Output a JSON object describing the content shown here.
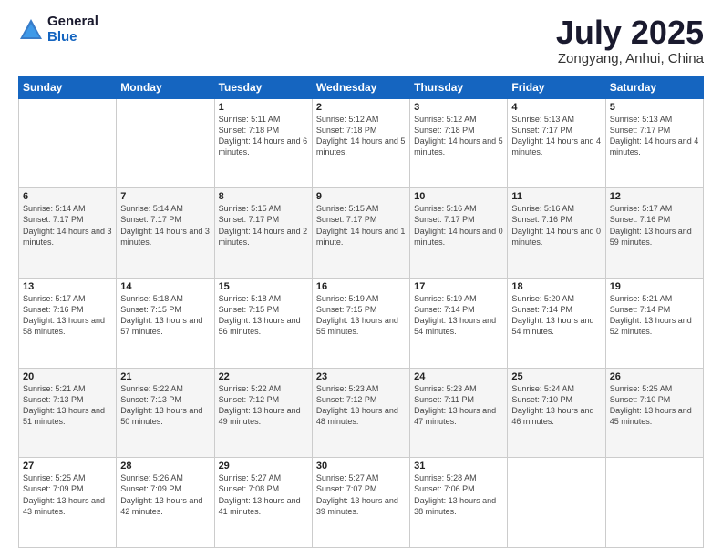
{
  "header": {
    "logo_general": "General",
    "logo_blue": "Blue",
    "month_title": "July 2025",
    "location": "Zongyang, Anhui, China"
  },
  "weekdays": [
    "Sunday",
    "Monday",
    "Tuesday",
    "Wednesday",
    "Thursday",
    "Friday",
    "Saturday"
  ],
  "weeks": [
    [
      {
        "day": "",
        "info": ""
      },
      {
        "day": "",
        "info": ""
      },
      {
        "day": "1",
        "info": "Sunrise: 5:11 AM\nSunset: 7:18 PM\nDaylight: 14 hours and 6 minutes."
      },
      {
        "day": "2",
        "info": "Sunrise: 5:12 AM\nSunset: 7:18 PM\nDaylight: 14 hours and 5 minutes."
      },
      {
        "day": "3",
        "info": "Sunrise: 5:12 AM\nSunset: 7:18 PM\nDaylight: 14 hours and 5 minutes."
      },
      {
        "day": "4",
        "info": "Sunrise: 5:13 AM\nSunset: 7:17 PM\nDaylight: 14 hours and 4 minutes."
      },
      {
        "day": "5",
        "info": "Sunrise: 5:13 AM\nSunset: 7:17 PM\nDaylight: 14 hours and 4 minutes."
      }
    ],
    [
      {
        "day": "6",
        "info": "Sunrise: 5:14 AM\nSunset: 7:17 PM\nDaylight: 14 hours and 3 minutes."
      },
      {
        "day": "7",
        "info": "Sunrise: 5:14 AM\nSunset: 7:17 PM\nDaylight: 14 hours and 3 minutes."
      },
      {
        "day": "8",
        "info": "Sunrise: 5:15 AM\nSunset: 7:17 PM\nDaylight: 14 hours and 2 minutes."
      },
      {
        "day": "9",
        "info": "Sunrise: 5:15 AM\nSunset: 7:17 PM\nDaylight: 14 hours and 1 minute."
      },
      {
        "day": "10",
        "info": "Sunrise: 5:16 AM\nSunset: 7:17 PM\nDaylight: 14 hours and 0 minutes."
      },
      {
        "day": "11",
        "info": "Sunrise: 5:16 AM\nSunset: 7:16 PM\nDaylight: 14 hours and 0 minutes."
      },
      {
        "day": "12",
        "info": "Sunrise: 5:17 AM\nSunset: 7:16 PM\nDaylight: 13 hours and 59 minutes."
      }
    ],
    [
      {
        "day": "13",
        "info": "Sunrise: 5:17 AM\nSunset: 7:16 PM\nDaylight: 13 hours and 58 minutes."
      },
      {
        "day": "14",
        "info": "Sunrise: 5:18 AM\nSunset: 7:15 PM\nDaylight: 13 hours and 57 minutes."
      },
      {
        "day": "15",
        "info": "Sunrise: 5:18 AM\nSunset: 7:15 PM\nDaylight: 13 hours and 56 minutes."
      },
      {
        "day": "16",
        "info": "Sunrise: 5:19 AM\nSunset: 7:15 PM\nDaylight: 13 hours and 55 minutes."
      },
      {
        "day": "17",
        "info": "Sunrise: 5:19 AM\nSunset: 7:14 PM\nDaylight: 13 hours and 54 minutes."
      },
      {
        "day": "18",
        "info": "Sunrise: 5:20 AM\nSunset: 7:14 PM\nDaylight: 13 hours and 54 minutes."
      },
      {
        "day": "19",
        "info": "Sunrise: 5:21 AM\nSunset: 7:14 PM\nDaylight: 13 hours and 52 minutes."
      }
    ],
    [
      {
        "day": "20",
        "info": "Sunrise: 5:21 AM\nSunset: 7:13 PM\nDaylight: 13 hours and 51 minutes."
      },
      {
        "day": "21",
        "info": "Sunrise: 5:22 AM\nSunset: 7:13 PM\nDaylight: 13 hours and 50 minutes."
      },
      {
        "day": "22",
        "info": "Sunrise: 5:22 AM\nSunset: 7:12 PM\nDaylight: 13 hours and 49 minutes."
      },
      {
        "day": "23",
        "info": "Sunrise: 5:23 AM\nSunset: 7:12 PM\nDaylight: 13 hours and 48 minutes."
      },
      {
        "day": "24",
        "info": "Sunrise: 5:23 AM\nSunset: 7:11 PM\nDaylight: 13 hours and 47 minutes."
      },
      {
        "day": "25",
        "info": "Sunrise: 5:24 AM\nSunset: 7:10 PM\nDaylight: 13 hours and 46 minutes."
      },
      {
        "day": "26",
        "info": "Sunrise: 5:25 AM\nSunset: 7:10 PM\nDaylight: 13 hours and 45 minutes."
      }
    ],
    [
      {
        "day": "27",
        "info": "Sunrise: 5:25 AM\nSunset: 7:09 PM\nDaylight: 13 hours and 43 minutes."
      },
      {
        "day": "28",
        "info": "Sunrise: 5:26 AM\nSunset: 7:09 PM\nDaylight: 13 hours and 42 minutes."
      },
      {
        "day": "29",
        "info": "Sunrise: 5:27 AM\nSunset: 7:08 PM\nDaylight: 13 hours and 41 minutes."
      },
      {
        "day": "30",
        "info": "Sunrise: 5:27 AM\nSunset: 7:07 PM\nDaylight: 13 hours and 39 minutes."
      },
      {
        "day": "31",
        "info": "Sunrise: 5:28 AM\nSunset: 7:06 PM\nDaylight: 13 hours and 38 minutes."
      },
      {
        "day": "",
        "info": ""
      },
      {
        "day": "",
        "info": ""
      }
    ]
  ]
}
